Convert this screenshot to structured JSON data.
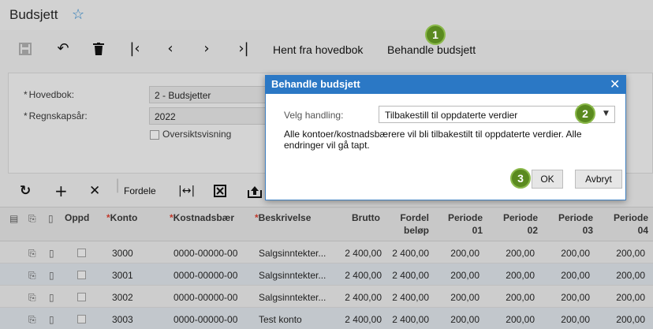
{
  "header": {
    "title": "Budsjett",
    "star_icon": "star-outline-icon"
  },
  "toolbar": {
    "icons": [
      "save-icon",
      "undo-icon",
      "delete-icon",
      "first-icon",
      "prev-icon",
      "next-icon",
      "last-icon"
    ],
    "hent_label": "Hent fra hovedbok",
    "behandle_label": "Behandle budsjett"
  },
  "filter": {
    "hovedbok_label": "Hovedbok:",
    "hovedbok_value": "2 - Budsjetter",
    "regnskapsar_label": "Regnskapsår:",
    "regnskapsar_value": "2022",
    "oversikt_label": "Oversiktsvisning",
    "required_mark": "*"
  },
  "grid_toolbar": {
    "fordele_label": "Fordele"
  },
  "table": {
    "headers": {
      "oppd": "Oppd",
      "konto": "Konto",
      "kostnadsbaer": "Kostnadsbær",
      "beskrivelse": "Beskrivelse",
      "brutto": "Brutto",
      "fordel_1": "Fordel",
      "fordel_2": "beløp",
      "p01_1": "Periode",
      "p01_2": "01",
      "p02_1": "Periode",
      "p02_2": "02",
      "p03_1": "Periode",
      "p03_2": "03",
      "p04_1": "Periode",
      "p04_2": "04",
      "required_mark": "*"
    },
    "rows": [
      {
        "konto": "3000",
        "kost": "0000-00000-00",
        "beskr": "Salgsinntekter...",
        "brutto": "2 400,00",
        "fordel": "2 400,00",
        "p01": "200,00",
        "p02": "200,00",
        "p03": "200,00",
        "p04": "200,00"
      },
      {
        "konto": "3001",
        "kost": "0000-00000-00",
        "beskr": "Salgsinntekter...",
        "brutto": "2 400,00",
        "fordel": "2 400,00",
        "p01": "200,00",
        "p02": "200,00",
        "p03": "200,00",
        "p04": "200,00"
      },
      {
        "konto": "3002",
        "kost": "0000-00000-00",
        "beskr": "Salgsinntekter...",
        "brutto": "2 400,00",
        "fordel": "2 400,00",
        "p01": "200,00",
        "p02": "200,00",
        "p03": "200,00",
        "p04": "200,00"
      },
      {
        "konto": "3003",
        "kost": "0000-00000-00",
        "beskr": "Test konto",
        "brutto": "2 400,00",
        "fordel": "2 400,00",
        "p01": "200,00",
        "p02": "200,00",
        "p03": "200,00",
        "p04": "200,00"
      }
    ]
  },
  "dialog": {
    "title": "Behandle budsjett",
    "label": "Velg handling:",
    "selected": "Tilbakestill til oppdaterte verdier",
    "message": "Alle kontoer/kostnadsbærere vil bli tilbakestilt til oppdaterte verdier. Alle endringer vil gå tapt.",
    "ok_label": "OK",
    "cancel_label": "Avbryt"
  },
  "callouts": {
    "one": "1",
    "two": "2",
    "three": "3"
  },
  "colors": {
    "dialog_header": "#2b78c5",
    "callout": "#5a8a1f",
    "required": "#c0392b"
  }
}
